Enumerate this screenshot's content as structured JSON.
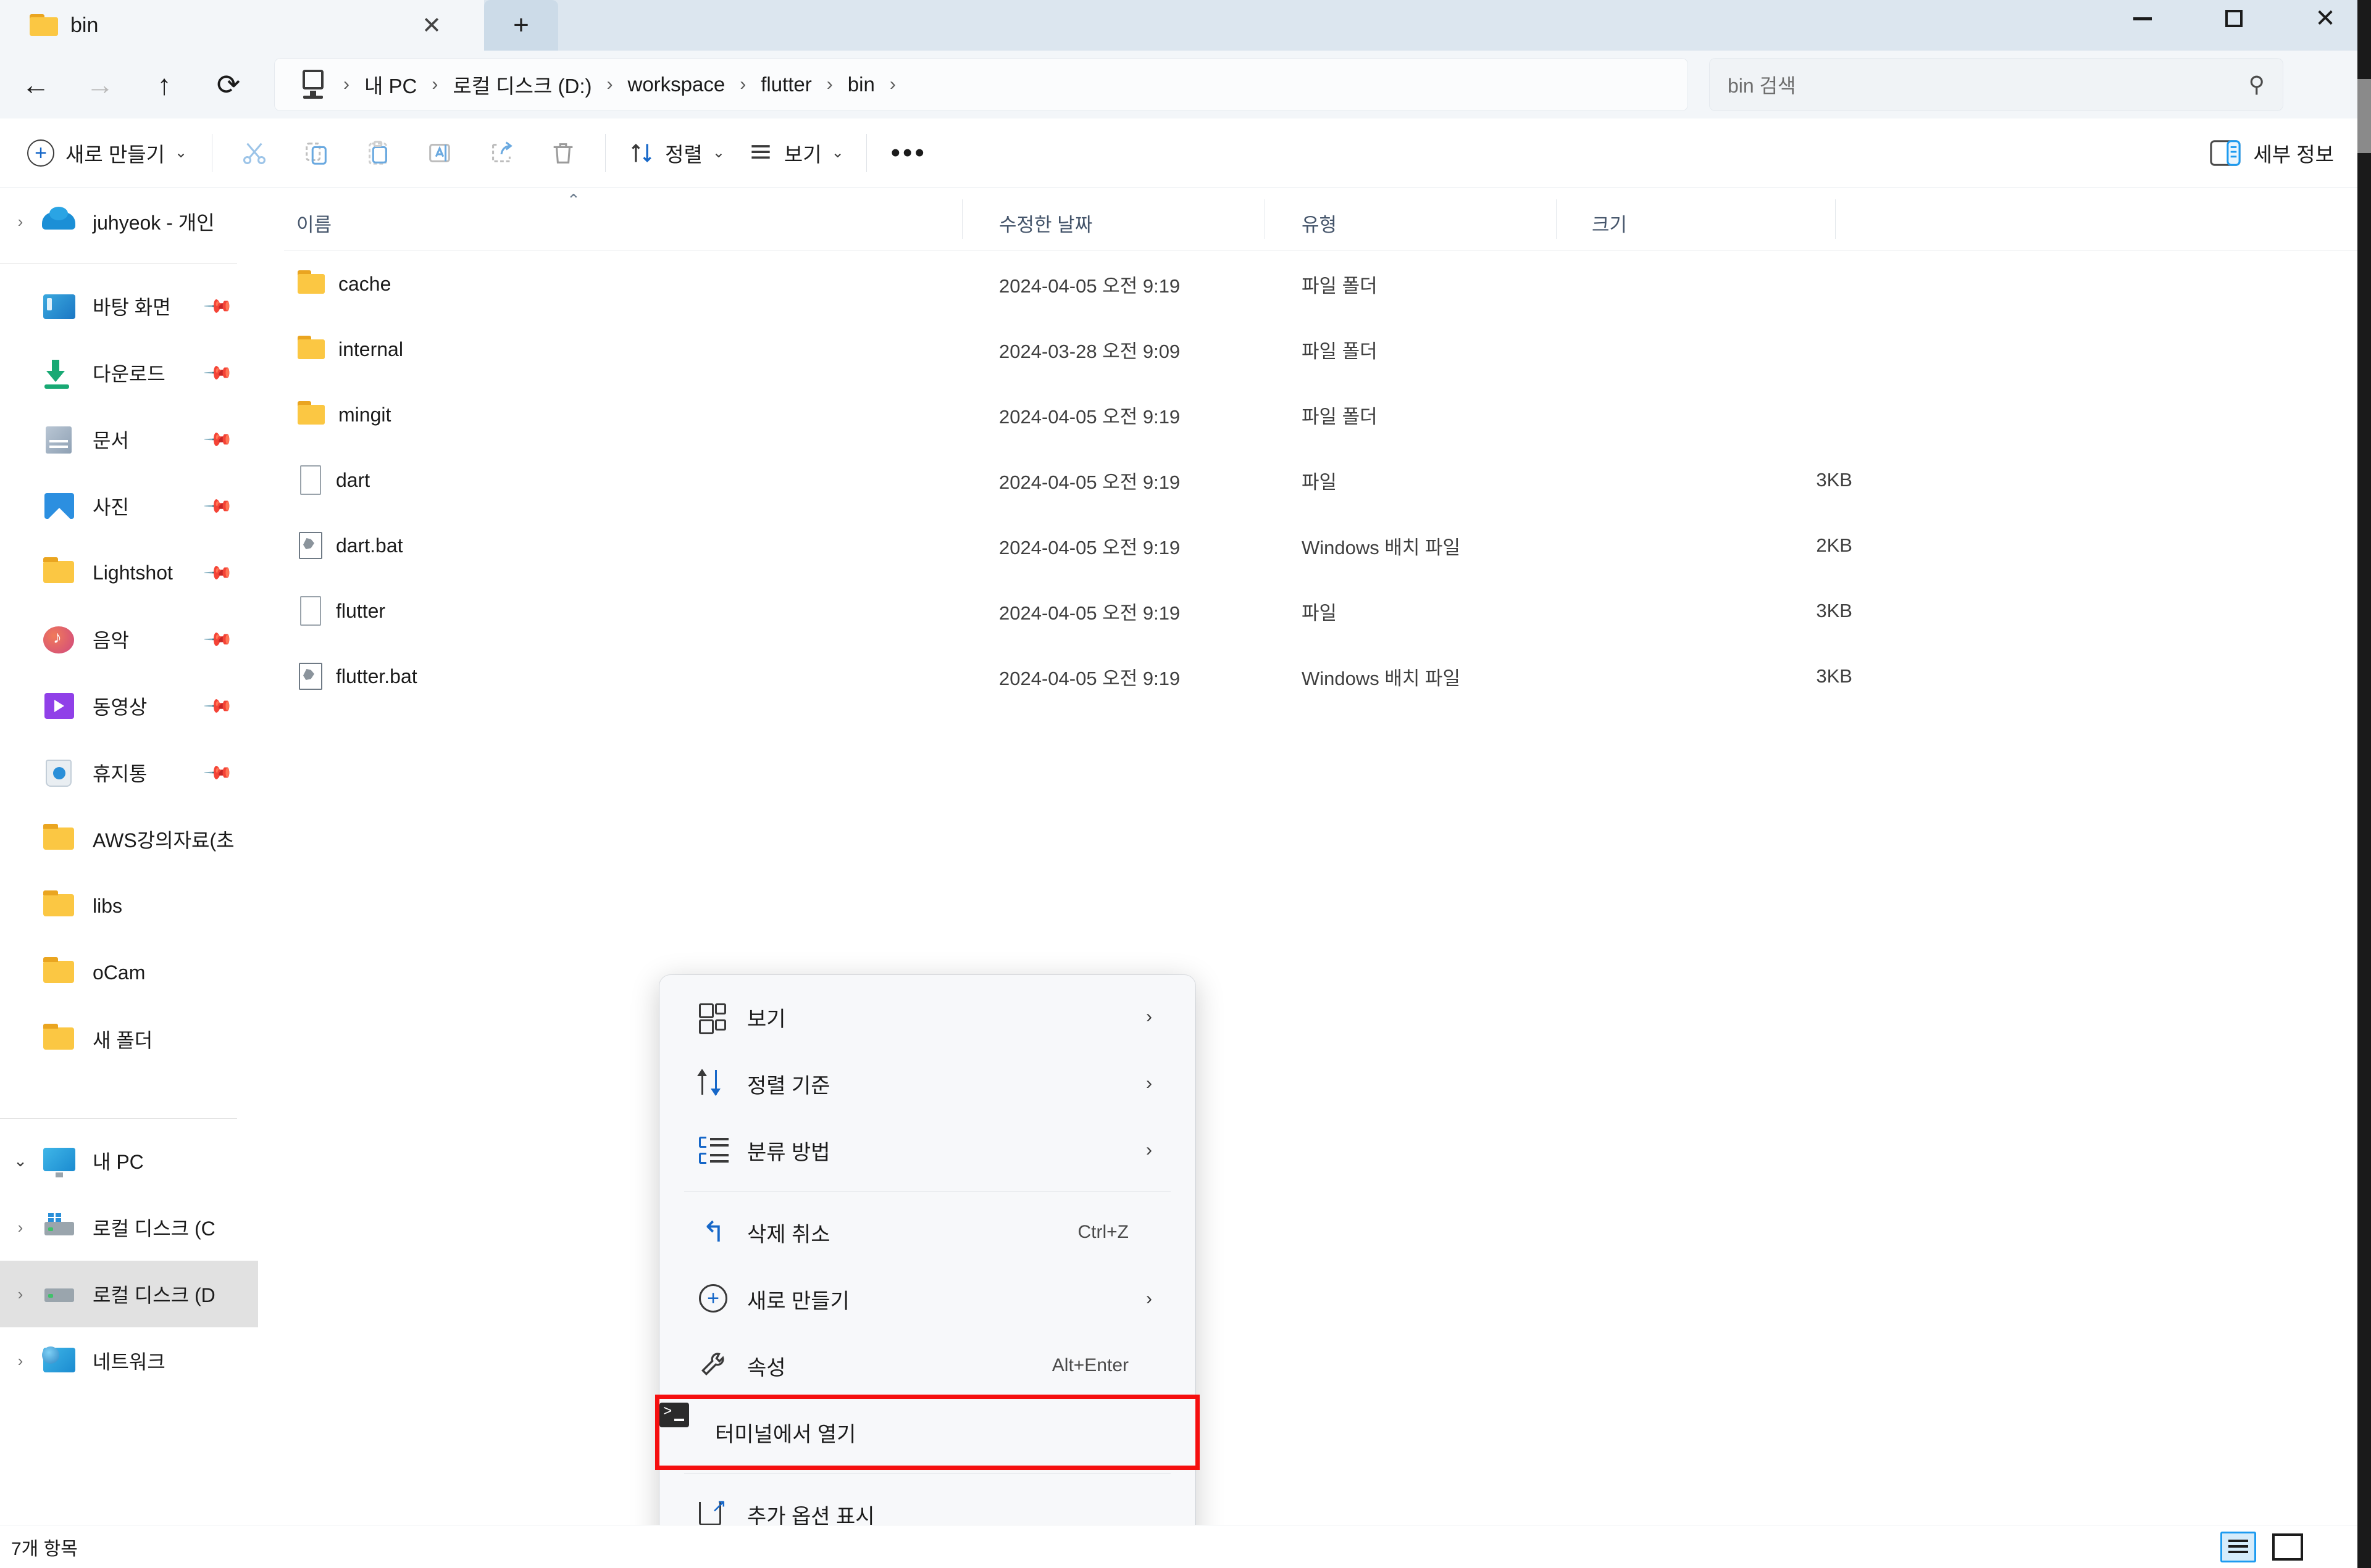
{
  "window": {
    "tab_title": "bin",
    "tab_close_glyph": "✕",
    "tab_new_glyph": "+",
    "minimize_label": "",
    "maximize_label": "",
    "close_label": "✕"
  },
  "nav": {
    "back_glyph": "←",
    "forward_glyph": "→",
    "up_glyph": "↑",
    "refresh_glyph": "⟳",
    "breadcrumbs": [
      {
        "label": "내 PC"
      },
      {
        "label": "로컬 디스크 (D:)"
      },
      {
        "label": "workspace"
      },
      {
        "label": "flutter"
      },
      {
        "label": "bin"
      }
    ],
    "separator": "›",
    "search_placeholder": "bin 검색",
    "search_icon": "search-icon"
  },
  "toolbar": {
    "new_label": "새로 만들기",
    "new_chevron": "⌄",
    "cut_icon": "scissors-icon",
    "copy_icon": "copy-icon",
    "paste_icon": "paste-icon",
    "rename_icon": "rename-icon",
    "share_icon": "share-icon",
    "delete_icon": "trash-icon",
    "sort_label": "정렬",
    "sort_chevron": "⌄",
    "view_label": "보기",
    "view_chevron": "⌄",
    "overflow_label": "•••",
    "details_label": "세부 정보"
  },
  "sidebar": {
    "items": [
      {
        "label": "juhyeok - 개인",
        "icon": "onedrive-cloud-icon",
        "chevron": "›",
        "pinned": false,
        "selected": false
      },
      {
        "label": "바탕 화면",
        "icon": "desktop-icon",
        "chevron": "",
        "pinned": true,
        "selected": false
      },
      {
        "label": "다운로드",
        "icon": "download-icon",
        "chevron": "",
        "pinned": true,
        "selected": false
      },
      {
        "label": "문서",
        "icon": "documents-icon",
        "chevron": "",
        "pinned": true,
        "selected": false
      },
      {
        "label": "사진",
        "icon": "pictures-icon",
        "chevron": "",
        "pinned": true,
        "selected": false
      },
      {
        "label": "Lightshot",
        "icon": "folder-icon",
        "chevron": "",
        "pinned": true,
        "selected": false
      },
      {
        "label": "음악",
        "icon": "music-icon",
        "chevron": "",
        "pinned": true,
        "selected": false
      },
      {
        "label": "동영상",
        "icon": "video-icon",
        "chevron": "",
        "pinned": true,
        "selected": false
      },
      {
        "label": "휴지통",
        "icon": "recycle-bin-icon",
        "chevron": "",
        "pinned": true,
        "selected": false
      },
      {
        "label": "AWS강의자료(초",
        "icon": "folder-icon",
        "chevron": "",
        "pinned": false,
        "selected": false
      },
      {
        "label": "libs",
        "icon": "folder-icon",
        "chevron": "",
        "pinned": false,
        "selected": false
      },
      {
        "label": "oCam",
        "icon": "folder-icon",
        "chevron": "",
        "pinned": false,
        "selected": false
      },
      {
        "label": "새 폴더",
        "icon": "folder-icon",
        "chevron": "",
        "pinned": false,
        "selected": false
      }
    ],
    "pc_items": [
      {
        "label": "내 PC",
        "icon": "pc-icon",
        "chevron": "⌄",
        "selected": false
      },
      {
        "label": "로컬 디스크 (C",
        "icon": "drive-windows-icon",
        "chevron": "›",
        "selected": false
      },
      {
        "label": "로컬 디스크 (D",
        "icon": "drive-icon",
        "chevron": "›",
        "selected": true
      },
      {
        "label": "네트워크",
        "icon": "network-icon",
        "chevron": "›",
        "selected": false
      }
    ]
  },
  "filelist": {
    "columns": [
      {
        "label": "이름"
      },
      {
        "label": "수정한 날짜"
      },
      {
        "label": "유형"
      },
      {
        "label": "크기"
      }
    ],
    "sort_caret": "⌃",
    "rows": [
      {
        "name": "cache",
        "icon": "folder-icon",
        "date": "2024-04-05 오전 9:19",
        "type": "파일 폴더",
        "size": ""
      },
      {
        "name": "internal",
        "icon": "folder-icon",
        "date": "2024-03-28 오전 9:09",
        "type": "파일 폴더",
        "size": ""
      },
      {
        "name": "mingit",
        "icon": "folder-icon",
        "date": "2024-04-05 오전 9:19",
        "type": "파일 폴더",
        "size": ""
      },
      {
        "name": "dart",
        "icon": "file-icon",
        "date": "2024-04-05 오전 9:19",
        "type": "파일",
        "size": "3KB"
      },
      {
        "name": "dart.bat",
        "icon": "bat-icon",
        "date": "2024-04-05 오전 9:19",
        "type": "Windows 배치 파일",
        "size": "2KB"
      },
      {
        "name": "flutter",
        "icon": "file-icon",
        "date": "2024-04-05 오전 9:19",
        "type": "파일",
        "size": "3KB"
      },
      {
        "name": "flutter.bat",
        "icon": "bat-icon",
        "date": "2024-04-05 오전 9:19",
        "type": "Windows 배치 파일",
        "size": "3KB"
      }
    ]
  },
  "context_menu": {
    "items": [
      {
        "label": "보기",
        "icon": "grid-view-icon",
        "accel": "",
        "arrow": "›",
        "highlight": false
      },
      {
        "label": "정렬 기준",
        "icon": "sort-icon",
        "accel": "",
        "arrow": "›",
        "highlight": false
      },
      {
        "label": "분류 방법",
        "icon": "group-by-icon",
        "accel": "",
        "arrow": "›",
        "highlight": false
      },
      {
        "label": "삭제 취소",
        "icon": "undo-icon",
        "accel": "Ctrl+Z",
        "arrow": "",
        "highlight": false
      },
      {
        "label": "새로 만들기",
        "icon": "plus-circle-icon",
        "accel": "",
        "arrow": "›",
        "highlight": false
      },
      {
        "label": "속성",
        "icon": "wrench-icon",
        "accel": "Alt+Enter",
        "arrow": "",
        "highlight": false
      },
      {
        "label": "터미널에서 열기",
        "icon": "terminal-icon",
        "accel": "",
        "arrow": "",
        "highlight": true
      },
      {
        "label": "추가 옵션 표시",
        "icon": "more-options-icon",
        "accel": "",
        "arrow": "",
        "highlight": false
      }
    ],
    "undo_glyph": "↰",
    "wrench_glyph": "⚲",
    "highlight_color": "#f50f0f"
  },
  "statusbar": {
    "item_count": "7개 항목",
    "details_view_icon": "details-view-icon",
    "large_icons_view_icon": "large-icons-view-icon"
  },
  "colors": {
    "accent": "#1667c8",
    "titlebar": "#dce6ef",
    "folder": "#fbc743",
    "highlight": "#f50f0f"
  }
}
